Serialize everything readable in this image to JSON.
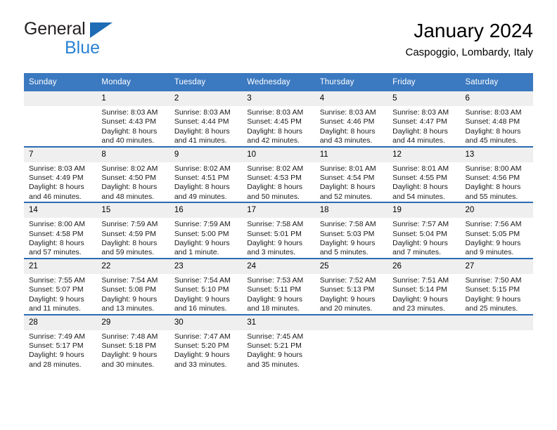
{
  "brand": {
    "name_line1": "General",
    "name_line2": "Blue",
    "accent_color": "#2a82d4",
    "triangle_color": "#1d6cb5"
  },
  "header": {
    "title": "January 2024",
    "subtitle": "Caspoggio, Lombardy, Italy"
  },
  "theme": {
    "header_bg": "#3b79c0",
    "row_rule": "#2e6bb3",
    "daynum_bg": "#efefef"
  },
  "weekdays": [
    "Sunday",
    "Monday",
    "Tuesday",
    "Wednesday",
    "Thursday",
    "Friday",
    "Saturday"
  ],
  "weeks": [
    [
      {
        "day": "",
        "sunrise": "",
        "sunset": "",
        "daylight1": "",
        "daylight2": ""
      },
      {
        "day": "1",
        "sunrise": "Sunrise: 8:03 AM",
        "sunset": "Sunset: 4:43 PM",
        "daylight1": "Daylight: 8 hours",
        "daylight2": "and 40 minutes."
      },
      {
        "day": "2",
        "sunrise": "Sunrise: 8:03 AM",
        "sunset": "Sunset: 4:44 PM",
        "daylight1": "Daylight: 8 hours",
        "daylight2": "and 41 minutes."
      },
      {
        "day": "3",
        "sunrise": "Sunrise: 8:03 AM",
        "sunset": "Sunset: 4:45 PM",
        "daylight1": "Daylight: 8 hours",
        "daylight2": "and 42 minutes."
      },
      {
        "day": "4",
        "sunrise": "Sunrise: 8:03 AM",
        "sunset": "Sunset: 4:46 PM",
        "daylight1": "Daylight: 8 hours",
        "daylight2": "and 43 minutes."
      },
      {
        "day": "5",
        "sunrise": "Sunrise: 8:03 AM",
        "sunset": "Sunset: 4:47 PM",
        "daylight1": "Daylight: 8 hours",
        "daylight2": "and 44 minutes."
      },
      {
        "day": "6",
        "sunrise": "Sunrise: 8:03 AM",
        "sunset": "Sunset: 4:48 PM",
        "daylight1": "Daylight: 8 hours",
        "daylight2": "and 45 minutes."
      }
    ],
    [
      {
        "day": "7",
        "sunrise": "Sunrise: 8:03 AM",
        "sunset": "Sunset: 4:49 PM",
        "daylight1": "Daylight: 8 hours",
        "daylight2": "and 46 minutes."
      },
      {
        "day": "8",
        "sunrise": "Sunrise: 8:02 AM",
        "sunset": "Sunset: 4:50 PM",
        "daylight1": "Daylight: 8 hours",
        "daylight2": "and 48 minutes."
      },
      {
        "day": "9",
        "sunrise": "Sunrise: 8:02 AM",
        "sunset": "Sunset: 4:51 PM",
        "daylight1": "Daylight: 8 hours",
        "daylight2": "and 49 minutes."
      },
      {
        "day": "10",
        "sunrise": "Sunrise: 8:02 AM",
        "sunset": "Sunset: 4:53 PM",
        "daylight1": "Daylight: 8 hours",
        "daylight2": "and 50 minutes."
      },
      {
        "day": "11",
        "sunrise": "Sunrise: 8:01 AM",
        "sunset": "Sunset: 4:54 PM",
        "daylight1": "Daylight: 8 hours",
        "daylight2": "and 52 minutes."
      },
      {
        "day": "12",
        "sunrise": "Sunrise: 8:01 AM",
        "sunset": "Sunset: 4:55 PM",
        "daylight1": "Daylight: 8 hours",
        "daylight2": "and 54 minutes."
      },
      {
        "day": "13",
        "sunrise": "Sunrise: 8:00 AM",
        "sunset": "Sunset: 4:56 PM",
        "daylight1": "Daylight: 8 hours",
        "daylight2": "and 55 minutes."
      }
    ],
    [
      {
        "day": "14",
        "sunrise": "Sunrise: 8:00 AM",
        "sunset": "Sunset: 4:58 PM",
        "daylight1": "Daylight: 8 hours",
        "daylight2": "and 57 minutes."
      },
      {
        "day": "15",
        "sunrise": "Sunrise: 7:59 AM",
        "sunset": "Sunset: 4:59 PM",
        "daylight1": "Daylight: 8 hours",
        "daylight2": "and 59 minutes."
      },
      {
        "day": "16",
        "sunrise": "Sunrise: 7:59 AM",
        "sunset": "Sunset: 5:00 PM",
        "daylight1": "Daylight: 9 hours",
        "daylight2": "and 1 minute."
      },
      {
        "day": "17",
        "sunrise": "Sunrise: 7:58 AM",
        "sunset": "Sunset: 5:01 PM",
        "daylight1": "Daylight: 9 hours",
        "daylight2": "and 3 minutes."
      },
      {
        "day": "18",
        "sunrise": "Sunrise: 7:58 AM",
        "sunset": "Sunset: 5:03 PM",
        "daylight1": "Daylight: 9 hours",
        "daylight2": "and 5 minutes."
      },
      {
        "day": "19",
        "sunrise": "Sunrise: 7:57 AM",
        "sunset": "Sunset: 5:04 PM",
        "daylight1": "Daylight: 9 hours",
        "daylight2": "and 7 minutes."
      },
      {
        "day": "20",
        "sunrise": "Sunrise: 7:56 AM",
        "sunset": "Sunset: 5:05 PM",
        "daylight1": "Daylight: 9 hours",
        "daylight2": "and 9 minutes."
      }
    ],
    [
      {
        "day": "21",
        "sunrise": "Sunrise: 7:55 AM",
        "sunset": "Sunset: 5:07 PM",
        "daylight1": "Daylight: 9 hours",
        "daylight2": "and 11 minutes."
      },
      {
        "day": "22",
        "sunrise": "Sunrise: 7:54 AM",
        "sunset": "Sunset: 5:08 PM",
        "daylight1": "Daylight: 9 hours",
        "daylight2": "and 13 minutes."
      },
      {
        "day": "23",
        "sunrise": "Sunrise: 7:54 AM",
        "sunset": "Sunset: 5:10 PM",
        "daylight1": "Daylight: 9 hours",
        "daylight2": "and 16 minutes."
      },
      {
        "day": "24",
        "sunrise": "Sunrise: 7:53 AM",
        "sunset": "Sunset: 5:11 PM",
        "daylight1": "Daylight: 9 hours",
        "daylight2": "and 18 minutes."
      },
      {
        "day": "25",
        "sunrise": "Sunrise: 7:52 AM",
        "sunset": "Sunset: 5:13 PM",
        "daylight1": "Daylight: 9 hours",
        "daylight2": "and 20 minutes."
      },
      {
        "day": "26",
        "sunrise": "Sunrise: 7:51 AM",
        "sunset": "Sunset: 5:14 PM",
        "daylight1": "Daylight: 9 hours",
        "daylight2": "and 23 minutes."
      },
      {
        "day": "27",
        "sunrise": "Sunrise: 7:50 AM",
        "sunset": "Sunset: 5:15 PM",
        "daylight1": "Daylight: 9 hours",
        "daylight2": "and 25 minutes."
      }
    ],
    [
      {
        "day": "28",
        "sunrise": "Sunrise: 7:49 AM",
        "sunset": "Sunset: 5:17 PM",
        "daylight1": "Daylight: 9 hours",
        "daylight2": "and 28 minutes."
      },
      {
        "day": "29",
        "sunrise": "Sunrise: 7:48 AM",
        "sunset": "Sunset: 5:18 PM",
        "daylight1": "Daylight: 9 hours",
        "daylight2": "and 30 minutes."
      },
      {
        "day": "30",
        "sunrise": "Sunrise: 7:47 AM",
        "sunset": "Sunset: 5:20 PM",
        "daylight1": "Daylight: 9 hours",
        "daylight2": "and 33 minutes."
      },
      {
        "day": "31",
        "sunrise": "Sunrise: 7:45 AM",
        "sunset": "Sunset: 5:21 PM",
        "daylight1": "Daylight: 9 hours",
        "daylight2": "and 35 minutes."
      },
      {
        "day": "",
        "sunrise": "",
        "sunset": "",
        "daylight1": "",
        "daylight2": ""
      },
      {
        "day": "",
        "sunrise": "",
        "sunset": "",
        "daylight1": "",
        "daylight2": ""
      },
      {
        "day": "",
        "sunrise": "",
        "sunset": "",
        "daylight1": "",
        "daylight2": ""
      }
    ]
  ]
}
